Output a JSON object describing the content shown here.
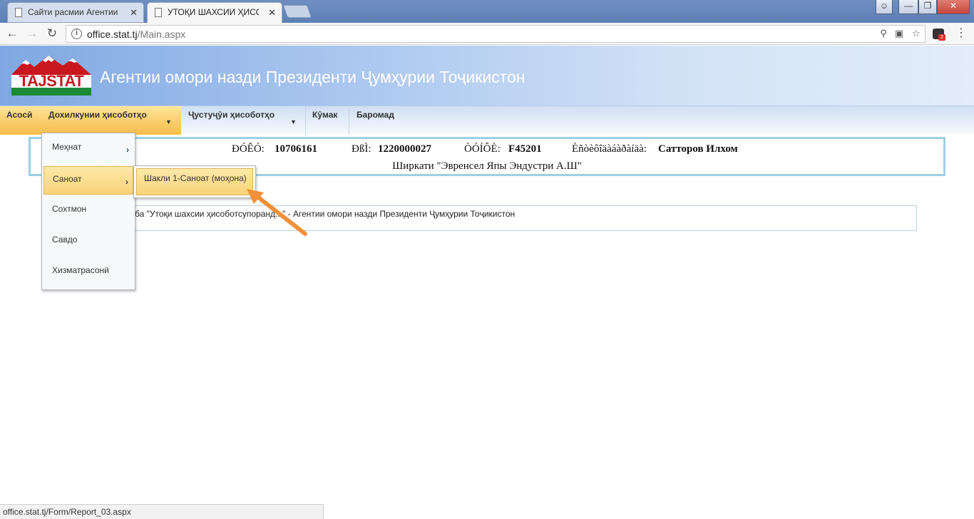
{
  "browser": {
    "tabs": [
      {
        "title": "Сайти расмии Агентии",
        "active": false
      },
      {
        "title": "УТОҚИ ШАХСИИ ҲИСОБ",
        "active": true
      }
    ],
    "url_host": "office.stat.tj",
    "url_path": "/Main.aspx"
  },
  "header": {
    "logo_text": "TAJSTAT",
    "title": "Агентии омори назди Президенти Ҷумҳурии Тоҷикистон"
  },
  "nav": {
    "items": [
      "Асосӣ",
      "Дохилкунии ҳисоботҳо",
      "Ҷустуҷӯи ҳисоботҳо",
      "Кӯмак",
      "Баромад"
    ]
  },
  "info": {
    "label1": "ÐÓÊÓ:",
    "value1": "10706161",
    "label2": "ÐßÌ:",
    "value2": "1220000027",
    "label3": "ÒÓÍÔÈ:",
    "value3": "F45201",
    "label4": "Èñòèôîäàáàðàíäà:",
    "value4": "Сатторов Илхом",
    "company": "Ширкати \"Эвренсел Япы Эндустри А.Ш\""
  },
  "report": {
    "text": "ба \"Утоқи шахсии ҳисоботсупоранд...\" - Агентии омори назди Президенти Ҷумҳурии Тоҷикистон"
  },
  "dropdown": {
    "items": [
      "Меҳнат",
      "Саноат",
      "Сохтмон",
      "Савдо",
      "Хизматрасонӣ"
    ],
    "submenu_item": "Шакли 1-Саноат (моҳона)"
  },
  "statusbar": {
    "text": "office.stat.tj/Form/Report_03.aspx"
  },
  "colors": {
    "menu_highlight": "#f9d27a",
    "header_blue": "#7fa8e2",
    "info_border": "#9fd0e3",
    "arrow": "#f0913a",
    "logo_red": "#c8171e",
    "logo_green": "#1a8a3a"
  }
}
